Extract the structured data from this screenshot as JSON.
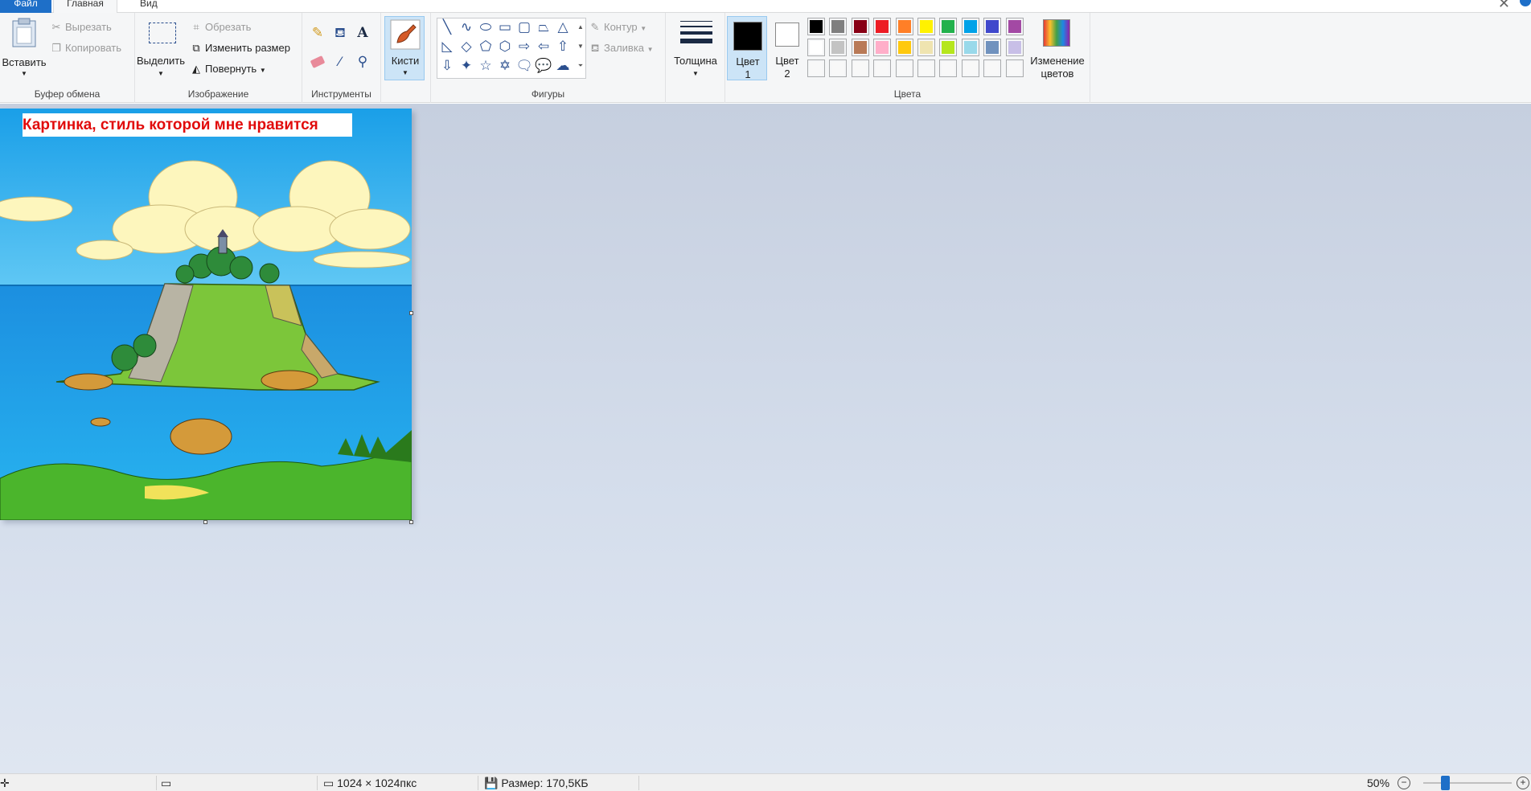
{
  "tabs": {
    "file": "Файл",
    "home": "Главная",
    "view": "Вид"
  },
  "clipboard": {
    "paste": "Вставить",
    "cut": "Вырезать",
    "copy": "Копировать",
    "group_label": "Буфер обмена"
  },
  "image": {
    "select": "Выделить",
    "crop": "Обрезать",
    "resize": "Изменить размер",
    "rotate": "Повернуть",
    "group_label": "Изображение"
  },
  "tools": {
    "group_label": "Инструменты"
  },
  "brushes": {
    "label": "Кисти"
  },
  "shapes": {
    "outline": "Контур",
    "fill": "Заливка",
    "group_label": "Фигуры"
  },
  "size": {
    "label": "Толщина"
  },
  "colors": {
    "color1_line1": "Цвет",
    "color1_line2": "1",
    "color2_line1": "Цвет",
    "color2_line2": "2",
    "edit_line1": "Изменение",
    "edit_line2": "цветов",
    "group_label": "Цвета",
    "palette_row1": [
      "#000000",
      "#7f7f7f",
      "#880015",
      "#ed1c24",
      "#ff7f27",
      "#fff200",
      "#22b14c",
      "#00a2e8",
      "#3f48cc",
      "#a349a4"
    ],
    "palette_row2": [
      "#ffffff",
      "#c3c3c3",
      "#b97a57",
      "#ffaec9",
      "#ffc90e",
      "#efe4b0",
      "#b5e61d",
      "#99d9ea",
      "#7092be",
      "#c8bfe7"
    ],
    "color1": "#000000",
    "color2": "#ffffff"
  },
  "canvas": {
    "caption": "Картинка, стиль которой мне нравится"
  },
  "status": {
    "dimensions": "1024 × 1024пкс",
    "file_size": "Размер: 170,5КБ",
    "zoom": "50%",
    "zoom_level": 0.5
  }
}
